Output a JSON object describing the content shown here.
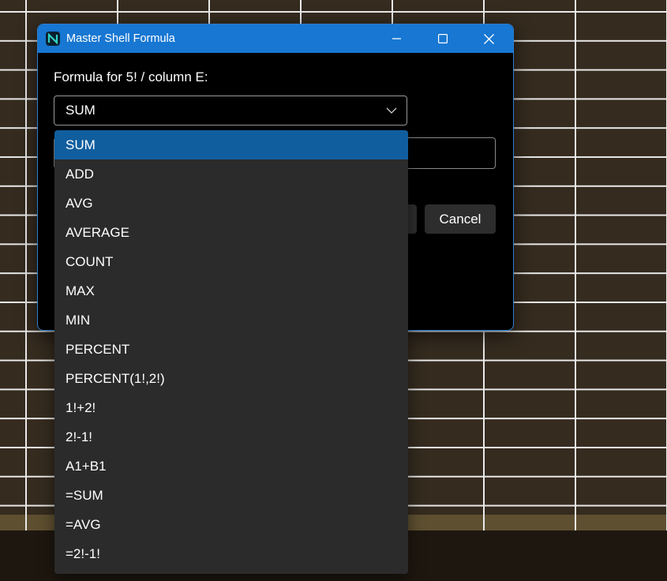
{
  "window": {
    "title": "Master Shell Formula",
    "app_icon_letter": "N"
  },
  "form": {
    "label": "Formula for 5! / column E:",
    "selected_value": "SUM",
    "cancel_label": "Cancel"
  },
  "dropdown": {
    "options": [
      "SUM",
      "ADD",
      "AVG",
      "AVERAGE",
      "COUNT",
      "MAX",
      "MIN",
      "PERCENT",
      "PERCENT(1!,2!)",
      "1!+2!",
      "2!-1!",
      "A1+B1",
      "=SUM",
      "=AVG",
      "=2!-1!"
    ],
    "selected_index": 0
  },
  "colors": {
    "titlebar": "#1777d2",
    "selected_option": "#115e9f",
    "dropdown_bg": "#2b2b2b"
  }
}
